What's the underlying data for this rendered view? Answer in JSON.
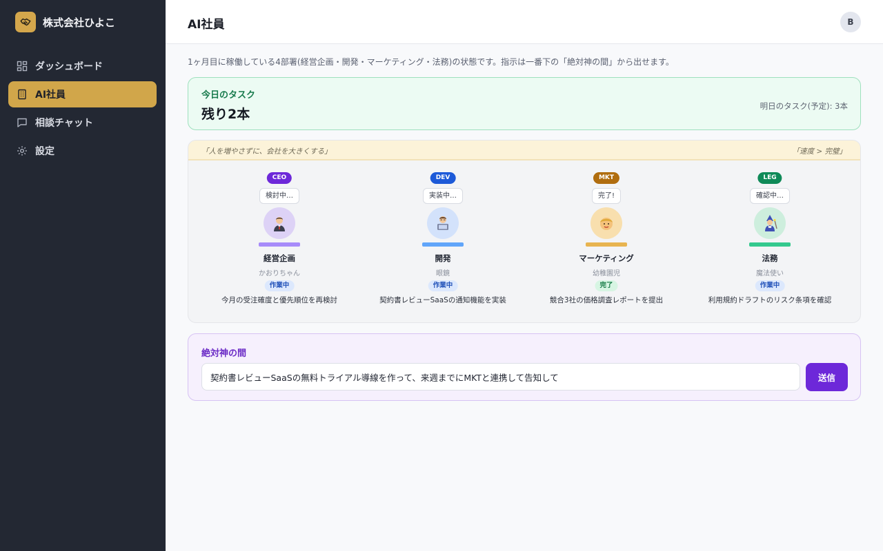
{
  "sidebar": {
    "brand": {
      "name": "株式会社ひよこ",
      "icon": "handshake-icon",
      "color": "#d4a74c"
    },
    "items": [
      {
        "label": "ダッシュボード",
        "icon": "dashboard-icon",
        "active": false
      },
      {
        "label": "AI社員",
        "icon": "building-icon",
        "active": true
      },
      {
        "label": "相談チャット",
        "icon": "chat-icon",
        "active": false
      },
      {
        "label": "設定",
        "icon": "gear-icon",
        "active": false
      }
    ]
  },
  "header": {
    "title": "AI社員",
    "avatar_initial": "B"
  },
  "main": {
    "intro": "1ヶ月目に稼働している4部署(経営企画・開発・マーケティング・法務)の状態です。指示は一番下の「絶対神の間」から出せます。",
    "today": {
      "label": "今日のタスク",
      "count": "残り2本",
      "tomorrow": "明日のタスク(予定): 3本"
    },
    "office": {
      "motto_left": "「人を増やさずに、会社を大きくする」",
      "motto_right": "「速度 > 完璧」",
      "staff": [
        {
          "role": "CEO",
          "role_color": "#6d28d9",
          "bubble": "検討中…",
          "face_bg": "#ddd2f6",
          "desk_color": "#a78bfa",
          "dept": "経営企画",
          "nick": "かおりちゃん",
          "status": "作業中",
          "status_kind": "working",
          "task": "今月の受注確度と優先順位を再検討",
          "avatar": "executive-avatar"
        },
        {
          "role": "DEV",
          "role_color": "#1d5ad8",
          "bubble": "実装中…",
          "face_bg": "#d3e2fb",
          "desk_color": "#60a5fa",
          "dept": "開発",
          "nick": "眼鏡",
          "status": "作業中",
          "status_kind": "working",
          "task": "契約書レビューSaaSの通知機能を実装",
          "avatar": "developer-avatar"
        },
        {
          "role": "MKT",
          "role_color": "#b06d0f",
          "bubble": "完了!",
          "face_bg": "#f8dfae",
          "desk_color": "#e8b450",
          "dept": "マーケティング",
          "nick": "幼稚園児",
          "status": "完了",
          "status_kind": "done",
          "task": "競合3社の価格調査レポートを提出",
          "avatar": "child-avatar"
        },
        {
          "role": "LEG",
          "role_color": "#0f8a58",
          "bubble": "確認中…",
          "face_bg": "#cdeedd",
          "desk_color": "#34c98e",
          "dept": "法務",
          "nick": "魔法使い",
          "status": "作業中",
          "status_kind": "working",
          "task": "利用規約ドラフトのリスク条項を確認",
          "avatar": "wizard-avatar"
        }
      ]
    },
    "god_room": {
      "title": "絶対神の間",
      "input_value": "契約書レビューSaaSの無料トライアル導線を作って、来週までにMKTと連携して告知して",
      "send_label": "送信"
    }
  }
}
